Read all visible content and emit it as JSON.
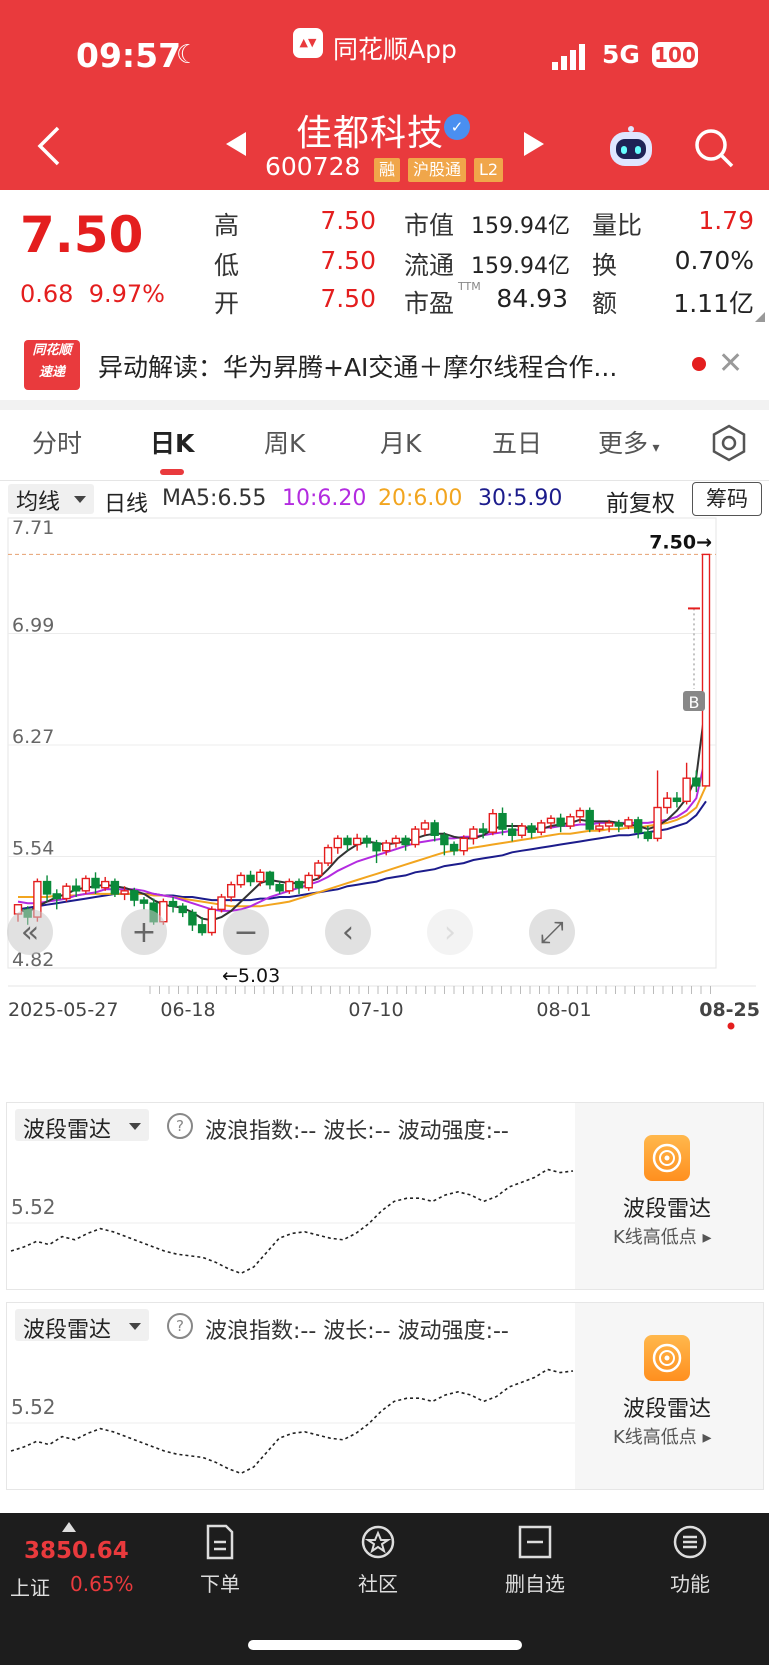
{
  "status": {
    "time": "09:57",
    "app": "同花顺App",
    "network": "5G",
    "battery": "100"
  },
  "header": {
    "name": "佳都科技",
    "code": "600728",
    "tags": [
      "融",
      "沪股通",
      "L2"
    ]
  },
  "quote": {
    "price": "7.50",
    "change": "0.68",
    "change_pct": "9.97%",
    "high_label": "高",
    "high": "7.50",
    "low_label": "低",
    "low": "7.50",
    "open_label": "开",
    "open": "7.50",
    "mcap_label": "市值",
    "mcap": "159.94亿",
    "float_label": "流通",
    "float": "159.94亿",
    "pe_label": "市盈",
    "pe_tag": "TTM",
    "pe": "84.93",
    "vr_label": "量比",
    "vr": "1.79",
    "turnover_label": "换",
    "turnover": "0.70%",
    "amount_label": "额",
    "amount": "1.11亿"
  },
  "news": {
    "logo_top": "同花顺",
    "logo_bottom": "速递",
    "text": "异动解读：华为昇腾+AI交通＋摩尔线程合作..."
  },
  "tabs": [
    "分时",
    "日K",
    "周K",
    "月K",
    "五日",
    "更多"
  ],
  "ma_bar": {
    "selector": "均线",
    "period": "日线",
    "ma5": "MA5:6.55",
    "ma10": "10:6.20",
    "ma20": "20:6.00",
    "ma30": "30:5.90",
    "adjust": "前复权",
    "chips": "筹码"
  },
  "colors": {
    "up": "#e41e1e",
    "down": "#0a8a3a",
    "ma5": "#333333",
    "ma10": "#b32be0",
    "ma20": "#f2a51f",
    "ma30": "#1c1c8c",
    "brand": "#e93a3d"
  },
  "chart_data": {
    "type": "candlestick",
    "y_ticks": [
      "7.71",
      "6.99",
      "6.27",
      "5.54",
      "4.82"
    ],
    "y_range": [
      4.82,
      7.71
    ],
    "x_ticks": [
      "2025-05-27",
      "06-18",
      "07-10",
      "08-01",
      "08-25"
    ],
    "last_price_label": "7.50→",
    "low_label": "←5.03",
    "buy_marker": "B",
    "candles": [
      [
        5.17,
        5.23,
        5.12,
        5.2
      ],
      [
        5.2,
        5.15,
        5.1,
        5.22
      ],
      [
        5.15,
        5.38,
        5.12,
        5.4
      ],
      [
        5.38,
        5.3,
        5.25,
        5.42
      ],
      [
        5.3,
        5.27,
        5.2,
        5.33
      ],
      [
        5.27,
        5.35,
        5.25,
        5.37
      ],
      [
        5.35,
        5.32,
        5.28,
        5.4
      ],
      [
        5.32,
        5.4,
        5.3,
        5.42
      ],
      [
        5.4,
        5.34,
        5.3,
        5.44
      ],
      [
        5.34,
        5.38,
        5.32,
        5.41
      ],
      [
        5.38,
        5.3,
        5.28,
        5.4
      ],
      [
        5.3,
        5.32,
        5.26,
        5.35
      ],
      [
        5.32,
        5.26,
        5.22,
        5.34
      ],
      [
        5.26,
        5.24,
        5.2,
        5.28
      ],
      [
        5.24,
        5.12,
        5.1,
        5.27
      ],
      [
        5.12,
        5.25,
        5.1,
        5.27
      ],
      [
        5.25,
        5.22,
        5.18,
        5.28
      ],
      [
        5.22,
        5.18,
        5.15,
        5.24
      ],
      [
        5.18,
        5.1,
        5.06,
        5.2
      ],
      [
        5.1,
        5.05,
        5.03,
        5.15
      ],
      [
        5.05,
        5.2,
        5.03,
        5.22
      ],
      [
        5.2,
        5.28,
        5.18,
        5.3
      ],
      [
        5.28,
        5.36,
        5.25,
        5.38
      ],
      [
        5.36,
        5.42,
        5.34,
        5.44
      ],
      [
        5.42,
        5.38,
        5.35,
        5.45
      ],
      [
        5.38,
        5.44,
        5.35,
        5.46
      ],
      [
        5.44,
        5.36,
        5.33,
        5.45
      ],
      [
        5.36,
        5.32,
        5.3,
        5.38
      ],
      [
        5.32,
        5.38,
        5.3,
        5.4
      ],
      [
        5.38,
        5.34,
        5.3,
        5.4
      ],
      [
        5.34,
        5.42,
        5.32,
        5.44
      ],
      [
        5.42,
        5.5,
        5.4,
        5.52
      ],
      [
        5.5,
        5.6,
        5.48,
        5.62
      ],
      [
        5.6,
        5.66,
        5.56,
        5.68
      ],
      [
        5.66,
        5.62,
        5.58,
        5.68
      ],
      [
        5.62,
        5.66,
        5.58,
        5.69
      ],
      [
        5.66,
        5.63,
        5.6,
        5.68
      ],
      [
        5.63,
        5.58,
        5.5,
        5.65
      ],
      [
        5.58,
        5.63,
        5.55,
        5.65
      ],
      [
        5.63,
        5.66,
        5.6,
        5.68
      ],
      [
        5.66,
        5.62,
        5.58,
        5.68
      ],
      [
        5.62,
        5.72,
        5.6,
        5.74
      ],
      [
        5.72,
        5.76,
        5.68,
        5.78
      ],
      [
        5.76,
        5.68,
        5.64,
        5.78
      ],
      [
        5.68,
        5.62,
        5.55,
        5.7
      ],
      [
        5.62,
        5.58,
        5.55,
        5.64
      ],
      [
        5.58,
        5.66,
        5.55,
        5.68
      ],
      [
        5.66,
        5.72,
        5.62,
        5.74
      ],
      [
        5.72,
        5.7,
        5.66,
        5.76
      ],
      [
        5.7,
        5.82,
        5.68,
        5.85
      ],
      [
        5.82,
        5.72,
        5.68,
        5.86
      ],
      [
        5.72,
        5.68,
        5.64,
        5.76
      ],
      [
        5.68,
        5.74,
        5.66,
        5.76
      ],
      [
        5.74,
        5.7,
        5.66,
        5.76
      ],
      [
        5.7,
        5.76,
        5.68,
        5.78
      ],
      [
        5.76,
        5.79,
        5.72,
        5.81
      ],
      [
        5.79,
        5.74,
        5.7,
        5.82
      ],
      [
        5.74,
        5.8,
        5.72,
        5.82
      ],
      [
        5.8,
        5.84,
        5.76,
        5.86
      ],
      [
        5.84,
        5.72,
        5.7,
        5.86
      ],
      [
        5.72,
        5.74,
        5.7,
        5.76
      ],
      [
        5.74,
        5.76,
        5.7,
        5.78
      ],
      [
        5.76,
        5.74,
        5.7,
        5.78
      ],
      [
        5.74,
        5.78,
        5.72,
        5.8
      ],
      [
        5.78,
        5.7,
        5.66,
        5.8
      ],
      [
        5.7,
        5.66,
        5.64,
        5.74
      ],
      [
        5.66,
        5.86,
        5.64,
        6.1
      ],
      [
        5.86,
        5.92,
        5.82,
        5.96
      ],
      [
        5.92,
        5.9,
        5.86,
        5.96
      ],
      [
        5.9,
        6.05,
        5.88,
        6.15
      ],
      [
        6.05,
        6.0,
        5.96,
        6.1
      ],
      [
        6.0,
        7.5,
        6.0,
        7.5
      ]
    ],
    "ma5": [
      5.2,
      5.18,
      5.22,
      5.25,
      5.28,
      5.3,
      5.33,
      5.34,
      5.35,
      5.36,
      5.35,
      5.34,
      5.32,
      5.3,
      5.26,
      5.23,
      5.22,
      5.21,
      5.18,
      5.14,
      5.13,
      5.15,
      5.19,
      5.25,
      5.31,
      5.37,
      5.39,
      5.38,
      5.37,
      5.37,
      5.38,
      5.4,
      5.46,
      5.53,
      5.58,
      5.62,
      5.64,
      5.63,
      5.62,
      5.63,
      5.64,
      5.66,
      5.68,
      5.69,
      5.69,
      5.67,
      5.66,
      5.66,
      5.68,
      5.72,
      5.74,
      5.74,
      5.74,
      5.72,
      5.72,
      5.74,
      5.75,
      5.76,
      5.78,
      5.77,
      5.77,
      5.77,
      5.76,
      5.75,
      5.74,
      5.72,
      5.74,
      5.78,
      5.84,
      5.92,
      6.06,
      6.55
    ],
    "ma10": [
      5.25,
      5.24,
      5.24,
      5.25,
      5.26,
      5.27,
      5.29,
      5.3,
      5.31,
      5.33,
      5.33,
      5.33,
      5.33,
      5.32,
      5.3,
      5.29,
      5.28,
      5.26,
      5.24,
      5.22,
      5.2,
      5.19,
      5.19,
      5.2,
      5.22,
      5.25,
      5.28,
      5.3,
      5.32,
      5.34,
      5.36,
      5.38,
      5.41,
      5.45,
      5.48,
      5.51,
      5.53,
      5.55,
      5.57,
      5.59,
      5.61,
      5.63,
      5.64,
      5.65,
      5.66,
      5.66,
      5.67,
      5.67,
      5.68,
      5.69,
      5.7,
      5.71,
      5.72,
      5.72,
      5.73,
      5.73,
      5.74,
      5.74,
      5.75,
      5.75,
      5.76,
      5.76,
      5.76,
      5.76,
      5.76,
      5.76,
      5.77,
      5.78,
      5.8,
      5.84,
      5.92,
      6.2
    ],
    "ma20": [
      5.28,
      5.28,
      5.28,
      5.28,
      5.29,
      5.29,
      5.29,
      5.3,
      5.3,
      5.3,
      5.3,
      5.3,
      5.3,
      5.3,
      5.29,
      5.29,
      5.28,
      5.27,
      5.26,
      5.25,
      5.24,
      5.23,
      5.22,
      5.22,
      5.22,
      5.22,
      5.23,
      5.24,
      5.25,
      5.27,
      5.29,
      5.31,
      5.33,
      5.35,
      5.37,
      5.39,
      5.41,
      5.43,
      5.45,
      5.47,
      5.49,
      5.51,
      5.53,
      5.55,
      5.57,
      5.58,
      5.59,
      5.6,
      5.61,
      5.62,
      5.63,
      5.64,
      5.65,
      5.66,
      5.67,
      5.68,
      5.69,
      5.69,
      5.7,
      5.71,
      5.71,
      5.72,
      5.72,
      5.73,
      5.73,
      5.74,
      5.75,
      5.76,
      5.78,
      5.81,
      5.86,
      6.0
    ],
    "ma30": [
      5.2,
      5.21,
      5.22,
      5.23,
      5.24,
      5.25,
      5.26,
      5.27,
      5.28,
      5.29,
      5.3,
      5.3,
      5.3,
      5.3,
      5.3,
      5.29,
      5.29,
      5.28,
      5.28,
      5.27,
      5.26,
      5.26,
      5.26,
      5.26,
      5.26,
      5.27,
      5.27,
      5.28,
      5.28,
      5.29,
      5.3,
      5.31,
      5.32,
      5.33,
      5.35,
      5.36,
      5.37,
      5.38,
      5.4,
      5.41,
      5.42,
      5.44,
      5.45,
      5.46,
      5.48,
      5.49,
      5.5,
      5.52,
      5.53,
      5.54,
      5.55,
      5.57,
      5.58,
      5.59,
      5.6,
      5.61,
      5.62,
      5.63,
      5.64,
      5.65,
      5.66,
      5.67,
      5.68,
      5.68,
      5.69,
      5.7,
      5.71,
      5.72,
      5.74,
      5.76,
      5.81,
      5.9
    ]
  },
  "controls": [
    "rewind",
    "zoom-in",
    "zoom-out",
    "prev",
    "next",
    "fullscreen"
  ],
  "radar": {
    "title": "波段雷达",
    "help": "?",
    "info": "波浪指数:--  波长:--  波动强度:--",
    "y_label": "5.52",
    "side_name": "波段雷达",
    "side_sub": "K线高低点 ▸",
    "wave": [
      0.3,
      0.35,
      0.42,
      0.38,
      0.48,
      0.44,
      0.52,
      0.58,
      0.54,
      0.48,
      0.42,
      0.36,
      0.3,
      0.26,
      0.24,
      0.22,
      0.16,
      0.08,
      0.02,
      0.1,
      0.28,
      0.46,
      0.52,
      0.54,
      0.5,
      0.46,
      0.44,
      0.52,
      0.64,
      0.8,
      0.92,
      0.96,
      0.96,
      0.92,
      1.0,
      1.04,
      1.0,
      0.92,
      0.98,
      1.1,
      1.16,
      1.22,
      1.32,
      1.28,
      1.3
    ]
  },
  "index": {
    "value": "3850.64",
    "name": "上证",
    "pct": "0.65%"
  },
  "nav": [
    {
      "label": "下单",
      "icon": "order-icon"
    },
    {
      "label": "社区",
      "icon": "community-icon"
    },
    {
      "label": "删自选",
      "icon": "remove-watchlist-icon"
    },
    {
      "label": "功能",
      "icon": "menu-icon"
    }
  ]
}
